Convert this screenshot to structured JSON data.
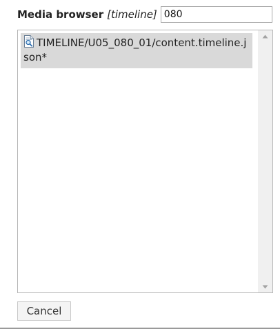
{
  "dialog": {
    "title": "Media browser",
    "title_context": "[timeline]"
  },
  "search": {
    "value": "080"
  },
  "results": {
    "items": [
      {
        "label": "TIMELINE/U05_080_01/content.timeline.json*",
        "icon": "document-search-icon",
        "selected": true
      }
    ]
  },
  "actions": {
    "cancel_label": "Cancel"
  },
  "colors": {
    "selected_row": "#d9d9d9",
    "scrollbar_track": "#f0f0f0",
    "border": "#b5b5b5"
  }
}
